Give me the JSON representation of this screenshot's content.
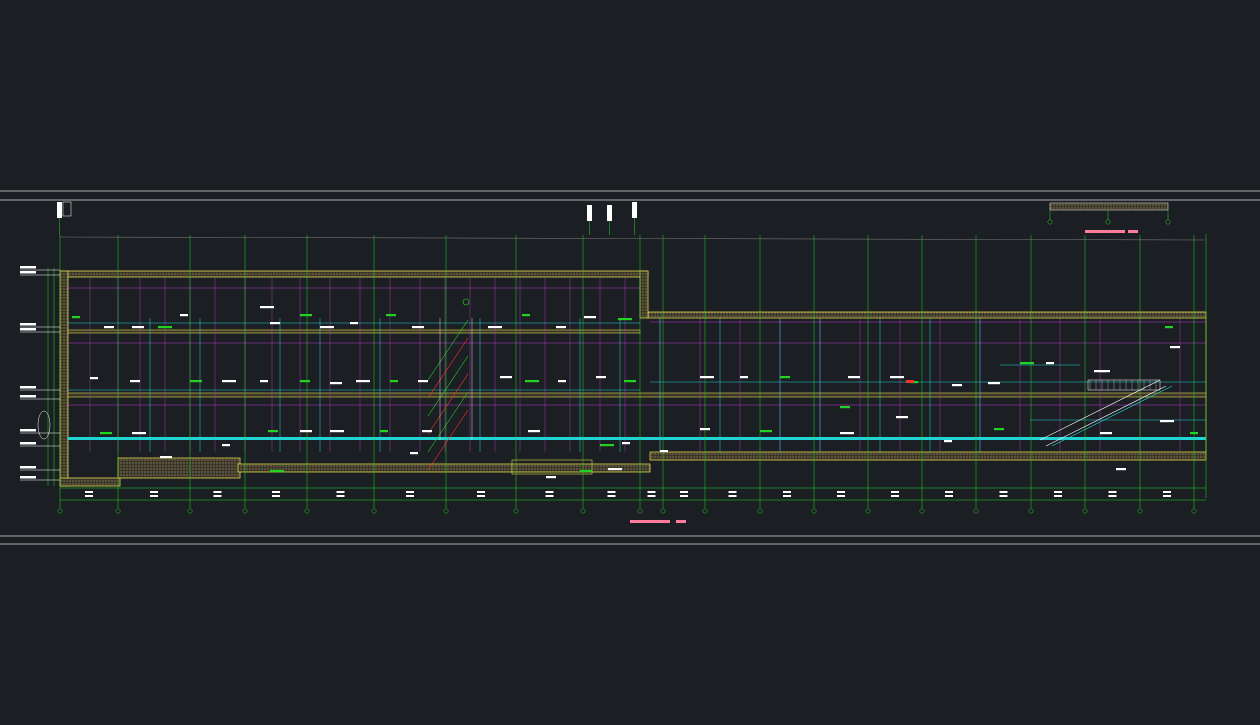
{
  "colors": {
    "background": "#1b1e23",
    "frame": "#d8d8d8",
    "structure": "#e0d84a",
    "hatch": "#a89a6e",
    "partition": "#c13bd6",
    "grid_line": "#20d420",
    "duct": "#20d4d4",
    "pipe": "#3a6cff",
    "red": "#ff3030",
    "title": "#ff7c9c",
    "white": "#ffffff"
  },
  "drawing": {
    "main_title_lines": 2,
    "sub_title_lines": 2,
    "grid_axes_count": 21,
    "levels_count": 8
  }
}
